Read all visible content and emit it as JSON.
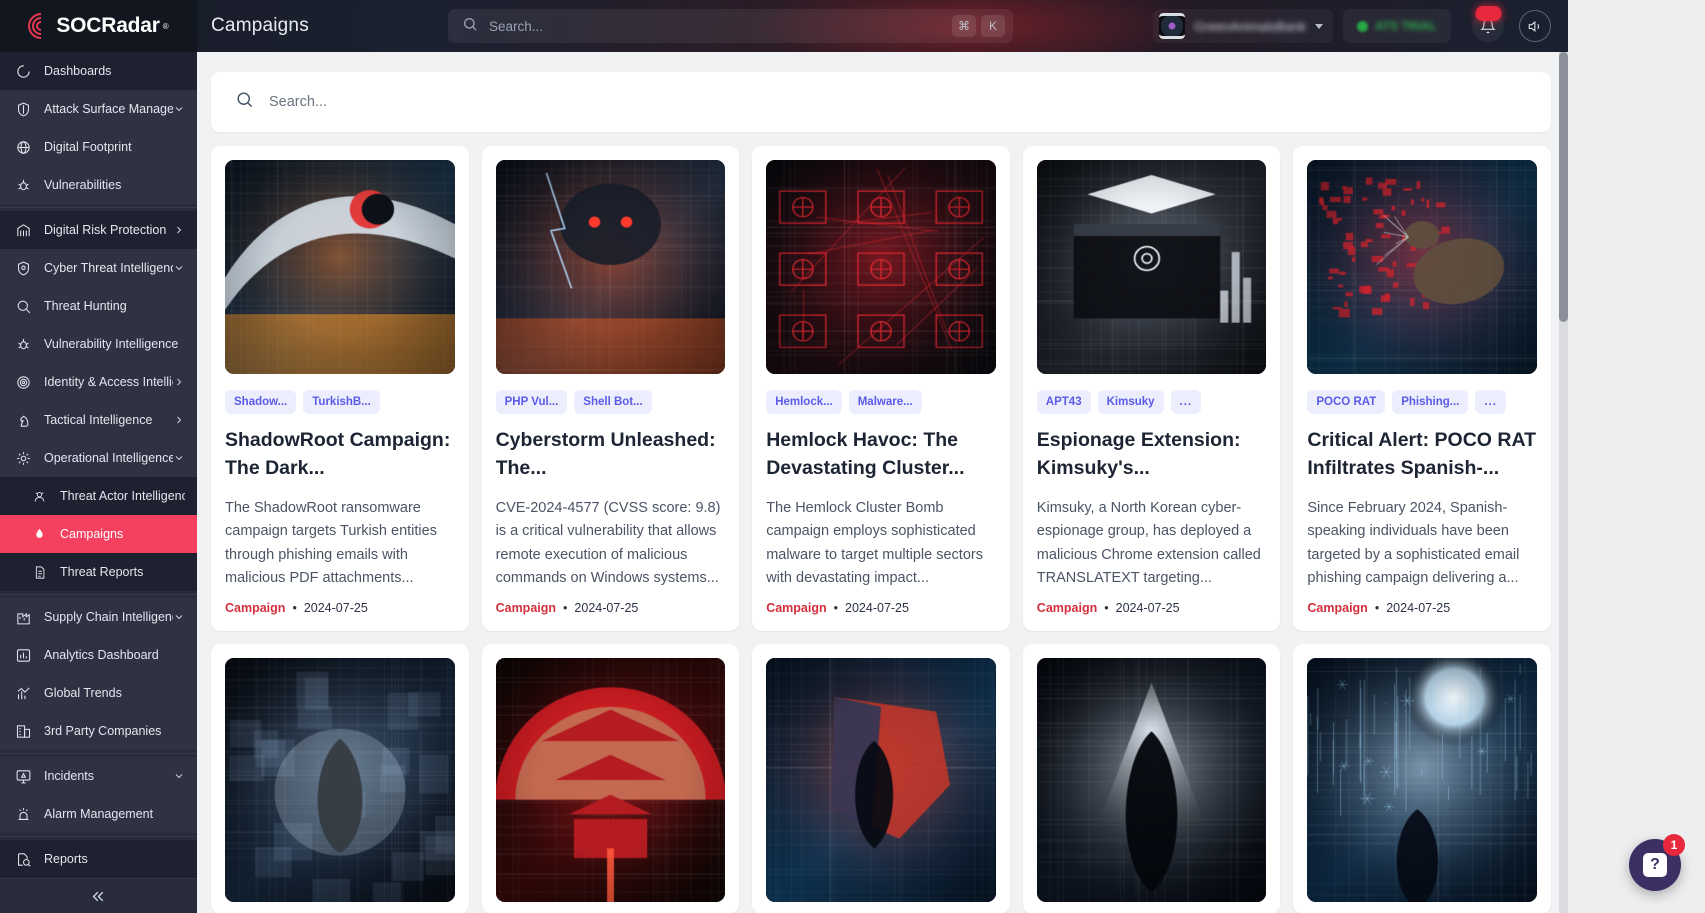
{
  "brand": {
    "name": "SOCRadar",
    "trademark": "®"
  },
  "header": {
    "page_title": "Campaigns",
    "search": {
      "placeholder": "Search...",
      "kbd_meta": "⌘",
      "kbd_key": "K"
    },
    "account": {
      "name": "GreenAnimalsBank"
    },
    "status": {
      "label": "ATS TRIAL"
    },
    "notification_badge": "",
    "icons": {
      "bell": "bell-icon",
      "sound": "sound-icon",
      "avatar": "avatar"
    }
  },
  "sidebar": {
    "collapse_label": "«",
    "items": [
      {
        "label": "Dashboards",
        "icon": "dashboard-icon",
        "level": 0,
        "chevron": "none",
        "style": "dark",
        "active": false
      },
      {
        "label": "Attack Surface Management",
        "icon": "shield-scan-icon",
        "level": 0,
        "chevron": "down",
        "style": "group",
        "active": false
      },
      {
        "label": "Digital Footprint",
        "icon": "globe-icon",
        "level": 0,
        "chevron": "none",
        "style": "group",
        "active": false
      },
      {
        "label": "Vulnerabilities",
        "icon": "bug-icon",
        "level": 0,
        "chevron": "none",
        "style": "group",
        "active": false
      },
      {
        "label": "Digital Risk Protection",
        "icon": "bank-icon",
        "level": 0,
        "chevron": "right",
        "style": "dark",
        "active": false
      },
      {
        "label": "Cyber Threat Intelligence",
        "icon": "shield-eye-icon",
        "level": 0,
        "chevron": "down",
        "style": "group",
        "active": false
      },
      {
        "label": "Threat Hunting",
        "icon": "search-icon",
        "level": 0,
        "chevron": "none",
        "style": "group",
        "active": false
      },
      {
        "label": "Vulnerability Intelligence",
        "icon": "bug-icon",
        "level": 0,
        "chevron": "none",
        "style": "group",
        "active": false
      },
      {
        "label": "Identity & Access Intelligence",
        "icon": "fingerprint-icon",
        "level": 0,
        "chevron": "right",
        "style": "group",
        "active": false
      },
      {
        "label": "Tactical Intelligence",
        "icon": "chess-knight-icon",
        "level": 0,
        "chevron": "right",
        "style": "group",
        "active": false
      },
      {
        "label": "Operational Intelligence",
        "icon": "gear-bug-icon",
        "level": 0,
        "chevron": "down",
        "style": "group",
        "active": false
      },
      {
        "label": "Threat Actor Intelligence",
        "icon": "hacker-icon",
        "level": 1,
        "chevron": "none",
        "style": "dark",
        "active": false
      },
      {
        "label": "Campaigns",
        "icon": "flame-icon",
        "level": 1,
        "chevron": "none",
        "style": "active",
        "active": true
      },
      {
        "label": "Threat Reports",
        "icon": "report-icon",
        "level": 1,
        "chevron": "none",
        "style": "dark",
        "active": false
      },
      {
        "label": "Supply Chain Intelligence",
        "icon": "factory-icon",
        "level": 0,
        "chevron": "down",
        "style": "group",
        "active": false
      },
      {
        "label": "Analytics Dashboard",
        "icon": "analytics-icon",
        "level": 0,
        "chevron": "none",
        "style": "group",
        "active": false
      },
      {
        "label": "Global Trends",
        "icon": "trends-icon",
        "level": 0,
        "chevron": "none",
        "style": "group",
        "active": false
      },
      {
        "label": "3rd Party Companies",
        "icon": "building-icon",
        "level": 0,
        "chevron": "none",
        "style": "group",
        "active": false
      },
      {
        "label": "Incidents",
        "icon": "alert-monitor-icon",
        "level": 0,
        "chevron": "down",
        "style": "group",
        "active": false
      },
      {
        "label": "Alarm Management",
        "icon": "siren-icon",
        "level": 0,
        "chevron": "none",
        "style": "group",
        "active": false
      },
      {
        "label": "Reports",
        "icon": "report-search-icon",
        "level": 0,
        "chevron": "none",
        "style": "dark",
        "active": false
      }
    ]
  },
  "main": {
    "search": {
      "placeholder": "Search..."
    },
    "cards": [
      {
        "tags": [
          "Shadow...",
          "TurkishB..."
        ],
        "title": "ShadowRoot Campaign: The Dark...",
        "desc": "The ShadowRoot ransomware campaign targets Turkish entities through phishing emails with malicious PDF attachments...",
        "type": "Campaign",
        "separator": "•",
        "date": "2024-07-25",
        "thumb": "shadowroot-turkish-flag-wave"
      },
      {
        "tags": [
          "PHP Vul...",
          "Shell Bot..."
        ],
        "title": "Cyberstorm Unleashed: The...",
        "desc": "CVE-2024-4577 (CVSS score: 9.8) is a critical vulnerability that allows remote execution of malicious commands on Windows systems...",
        "type": "Campaign",
        "separator": "•",
        "date": "2024-07-25",
        "thumb": "cyberstorm-skull-lightning"
      },
      {
        "tags": [
          "Hemlock...",
          "Malware..."
        ],
        "title": "Hemlock Havoc: The Devastating Cluster...",
        "desc": "The Hemlock Cluster Bomb campaign employs sophisticated malware to target multiple sectors with devastating impact...",
        "type": "Campaign",
        "separator": "•",
        "date": "2024-07-25",
        "thumb": "cluster-bomb-red-nodes"
      },
      {
        "tags": [
          "APT43",
          "Kimsuky",
          "..."
        ],
        "title": "Espionage Extension: Kimsuky's...",
        "desc": "Kimsuky, a North Korean cyber-espionage group, has deployed a malicious Chrome extension called TRANSLATEXT targeting...",
        "type": "Campaign",
        "separator": "•",
        "date": "2024-07-25",
        "thumb": "translatext-chrome-extension"
      },
      {
        "tags": [
          "POCO RAT",
          "Phishing...",
          "..."
        ],
        "title": "Critical Alert: POCO RAT Infiltrates Spanish-...",
        "desc": "Since February 2024, Spanish-speaking individuals have been targeted by a sophisticated email phishing campaign delivering a...",
        "type": "Campaign",
        "separator": "•",
        "date": "2024-07-25",
        "thumb": "poco-rat-world-map"
      },
      {
        "tags": [],
        "title": "",
        "desc": "",
        "type": "",
        "separator": "",
        "date": "",
        "thumb": "operation-niki-hacker"
      },
      {
        "tags": [],
        "title": "",
        "desc": "",
        "type": "",
        "separator": "",
        "date": "",
        "thumb": "red-pagoda-temple"
      },
      {
        "tags": [],
        "title": "",
        "desc": "",
        "type": "",
        "separator": "",
        "date": "",
        "thumb": "spain-map-hacker"
      },
      {
        "tags": [],
        "title": "",
        "desc": "",
        "type": "",
        "separator": "",
        "date": "",
        "thumb": "ghost-hooded-figure"
      },
      {
        "tags": [],
        "title": "",
        "desc": "",
        "type": "",
        "separator": "",
        "date": "",
        "thumb": "winter-moon-hacker"
      }
    ]
  },
  "chat": {
    "icon": "question-icon",
    "glyph": "?",
    "unread": "1"
  },
  "colors": {
    "accent_red": "#f5415f",
    "campaign_red": "#d32f3c",
    "tag_bg": "#eceefd",
    "tag_fg": "#5b5be8",
    "sidebar_bg": "#272b3a",
    "page_bg": "#f1f2f4"
  }
}
